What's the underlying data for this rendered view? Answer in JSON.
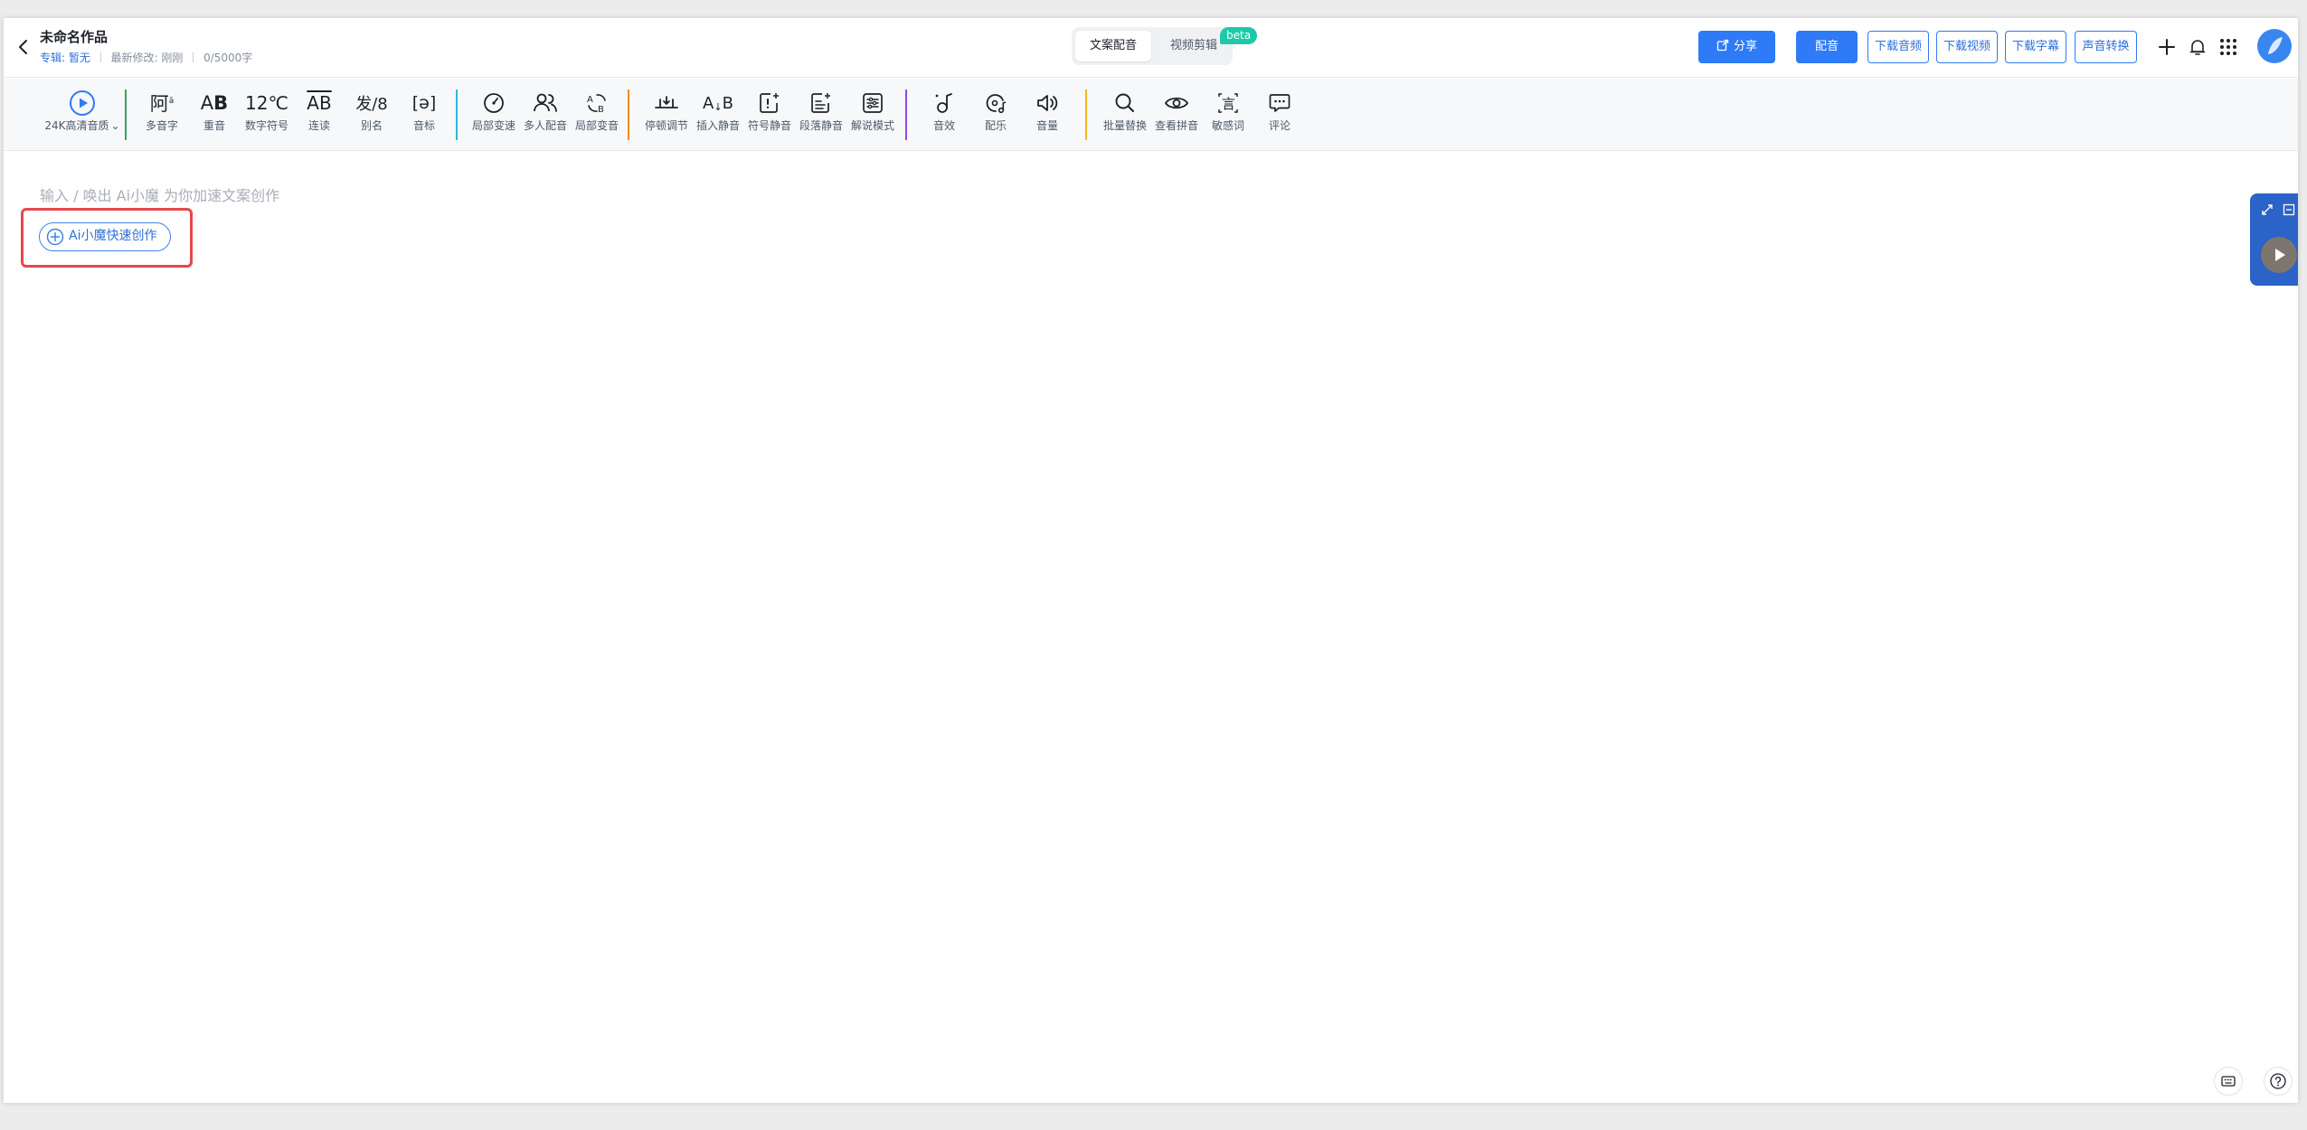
{
  "header": {
    "title": "未命名作品",
    "album_label": "专辑:",
    "album_value": "暂无",
    "last_modified": "最新修改: 刚刚",
    "word_count": "0/5000字",
    "tabs": [
      {
        "label": "文案配音",
        "active": true
      },
      {
        "label": "视频剪辑",
        "active": false
      }
    ],
    "beta_badge": "beta",
    "buttons": {
      "share": "分享",
      "dub": "配音",
      "download_audio": "下载音频",
      "download_video": "下载视频",
      "download_subtitle": "下载字幕",
      "voice_convert": "声音转换"
    },
    "icons": [
      "back-icon",
      "add-icon",
      "bell-icon",
      "apps-grid-icon",
      "avatar"
    ]
  },
  "toolbar": {
    "quality": {
      "label": "24K高清音质",
      "icon": "play-circle-icon"
    },
    "groups": [
      {
        "color": "#3aa55a",
        "items": [
          {
            "label": "多音字",
            "glyph": "阿",
            "icon": "polyphone-icon"
          },
          {
            "label": "重音",
            "glyph": "AB",
            "icon": "stress-icon"
          },
          {
            "label": "数字符号",
            "glyph": "12℃",
            "icon": "number-symbol-icon"
          },
          {
            "label": "连读",
            "glyph": "AB",
            "icon": "liaison-icon"
          },
          {
            "label": "别名",
            "glyph": "发/8",
            "icon": "alias-icon"
          },
          {
            "label": "音标",
            "glyph": "[ə]",
            "icon": "phonetic-icon"
          }
        ]
      },
      {
        "color": "#2eb8d8",
        "items": [
          {
            "label": "局部变速",
            "icon": "speed-gauge-icon"
          },
          {
            "label": "多人配音",
            "icon": "multi-person-icon"
          },
          {
            "label": "局部变音",
            "icon": "voice-change-icon"
          }
        ]
      },
      {
        "color": "#f08a24",
        "items": [
          {
            "label": "停顿调节",
            "icon": "pause-adjust-icon"
          },
          {
            "label": "插入静音",
            "icon": "insert-silence-icon"
          },
          {
            "label": "符号静音",
            "icon": "symbol-silence-icon"
          },
          {
            "label": "段落静音",
            "icon": "paragraph-silence-icon"
          },
          {
            "label": "解说模式",
            "icon": "narration-mode-icon"
          }
        ]
      },
      {
        "color": "#8b4ae6",
        "items": [
          {
            "label": "音效",
            "icon": "sound-effect-icon"
          },
          {
            "label": "配乐",
            "icon": "music-icon"
          },
          {
            "label": "音量",
            "icon": "volume-icon"
          }
        ]
      },
      {
        "color": "#f2b51c",
        "items": [
          {
            "label": "批量替换",
            "icon": "search-icon"
          },
          {
            "label": "查看拼音",
            "icon": "eye-icon"
          },
          {
            "label": "敏感词",
            "icon": "sensitive-word-icon"
          },
          {
            "label": "评论",
            "icon": "comment-icon"
          }
        ]
      }
    ]
  },
  "editor": {
    "placeholder": "输入 / 唤出 Ai小魔 为你加速文案创作",
    "ai_button": "Ai小魔快速创作"
  },
  "colors": {
    "primary": "#2f7af6",
    "highlight": "#e5484d",
    "beta": "#1fc8a8",
    "side_panel": "#2b63c8"
  }
}
